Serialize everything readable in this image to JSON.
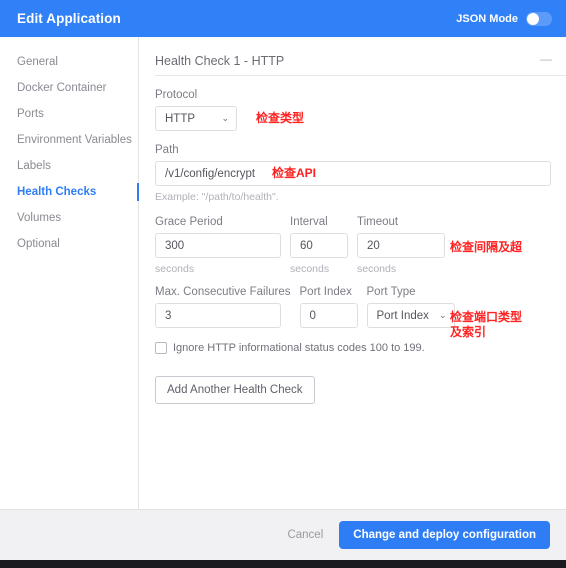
{
  "titlebar": {
    "title": "Edit Application",
    "json_mode_label": "JSON Mode",
    "toggle_state": "off",
    "background": "#3080f8"
  },
  "sidebar": {
    "items": [
      {
        "label": "General",
        "active": false
      },
      {
        "label": "Docker Container",
        "active": false
      },
      {
        "label": "Ports",
        "active": false
      },
      {
        "label": "Environment Variables",
        "active": false
      },
      {
        "label": "Labels",
        "active": false
      },
      {
        "label": "Health Checks",
        "active": true
      },
      {
        "label": "Volumes",
        "active": false
      },
      {
        "label": "Optional",
        "active": false
      }
    ],
    "active_color": "#2f7df4"
  },
  "card": {
    "title": "Health Check 1 - HTTP",
    "collapse_icon": "—",
    "protocol": {
      "label": "Protocol",
      "value": "HTTP",
      "chevron": "⌄"
    },
    "path": {
      "label": "Path",
      "value": "/v1/config/encrypt",
      "placeholder": "/path/to/health",
      "hint": "Example: \"/path/to/health\"."
    },
    "timing": [
      {
        "label": "Grace Period",
        "value": "300",
        "unit": "seconds"
      },
      {
        "label": "Interval",
        "value": "60",
        "unit": "seconds"
      },
      {
        "label": "Timeout",
        "value": "20",
        "unit": "seconds"
      }
    ],
    "failure_row": {
      "max_failures": {
        "label": "Max. Consecutive Failures",
        "value": "3"
      },
      "port_index": {
        "label": "Port Index",
        "value": "0"
      },
      "port_type": {
        "label": "Port Type",
        "value": "Port Index",
        "chevron": "⌄"
      }
    },
    "ignore_checkbox": {
      "label": "Ignore HTTP informational status codes 100 to 199.",
      "checked": false
    },
    "add_button": "Add Another Health Check"
  },
  "annotations": {
    "color": "#ff2222",
    "protocol": "检查类型",
    "path": "检查API",
    "timing": "检查间隔及超",
    "port": "检查端口类型及索引"
  },
  "footer": {
    "cancel_label": "Cancel",
    "deploy_label": "Change and deploy configuration",
    "deploy_color": "#2f7df4"
  }
}
